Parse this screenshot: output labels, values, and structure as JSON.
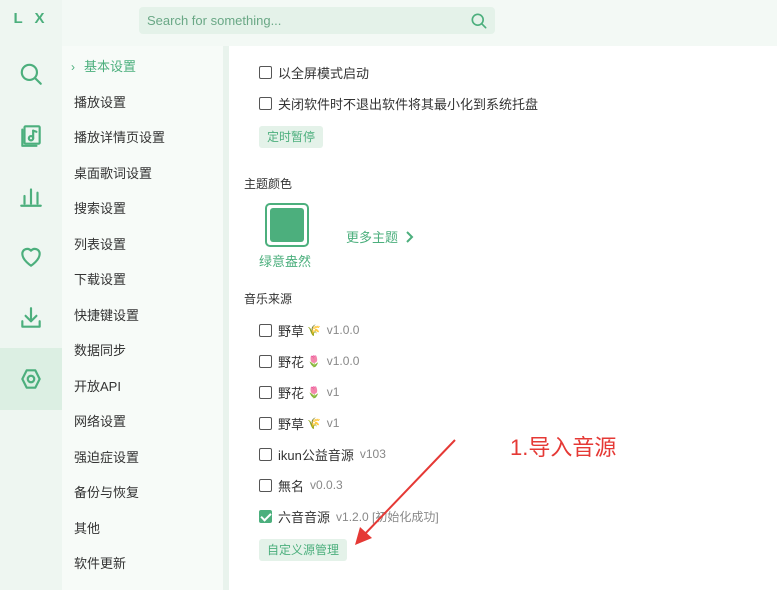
{
  "app": {
    "logo": "L X"
  },
  "search": {
    "placeholder": "Search for something..."
  },
  "rail": {
    "icons": [
      "search-icon",
      "music-list-icon",
      "chart-icon",
      "heart-icon",
      "download-icon",
      "settings-icon"
    ],
    "active": "settings-icon"
  },
  "sidebar": {
    "items": [
      {
        "label": "基本设置"
      },
      {
        "label": "播放设置"
      },
      {
        "label": "播放详情页设置"
      },
      {
        "label": "桌面歌词设置"
      },
      {
        "label": "搜索设置"
      },
      {
        "label": "列表设置"
      },
      {
        "label": "下载设置"
      },
      {
        "label": "快捷键设置"
      },
      {
        "label": "数据同步"
      },
      {
        "label": "开放API"
      },
      {
        "label": "网络设置"
      },
      {
        "label": "强迫症设置"
      },
      {
        "label": "备份与恢复"
      },
      {
        "label": "其他"
      },
      {
        "label": "软件更新"
      }
    ]
  },
  "settings": {
    "fullscreen_label": "以全屏模式启动",
    "minimize_tray_label": "关闭软件时不退出软件将其最小化到系统托盘",
    "timer_button": "定时暂停"
  },
  "theme": {
    "title": "主题颜色",
    "current_name": "绿意盎然",
    "current_color": "#4caf7d",
    "more_label": "更多主题"
  },
  "sources": {
    "title": "音乐来源",
    "items": [
      {
        "name": "野草",
        "emoji": "🌾",
        "version": "v1.0.0",
        "checked": false
      },
      {
        "name": "野花",
        "emoji": "🌷",
        "version": "v1.0.0",
        "checked": false
      },
      {
        "name": "野花",
        "emoji": "🌷",
        "version": "v1",
        "checked": false
      },
      {
        "name": "野草",
        "emoji": "🌾",
        "version": "v1",
        "checked": false
      },
      {
        "name": "ikun公益音源",
        "emoji": "",
        "version": "v103",
        "checked": false
      },
      {
        "name": "無名",
        "emoji": "",
        "version": "v0.0.3",
        "checked": false
      },
      {
        "name": "六音音源",
        "emoji": "",
        "version": "v1.2.0 [初始化成功]",
        "checked": true
      }
    ],
    "manage_button": "自定义源管理"
  },
  "annotation": {
    "text": "1.导入音源",
    "color": "#e53935"
  },
  "colors": {
    "accent": "#4caf7d",
    "rail_bg": "#eef6f1",
    "annotation": "#e53935"
  }
}
